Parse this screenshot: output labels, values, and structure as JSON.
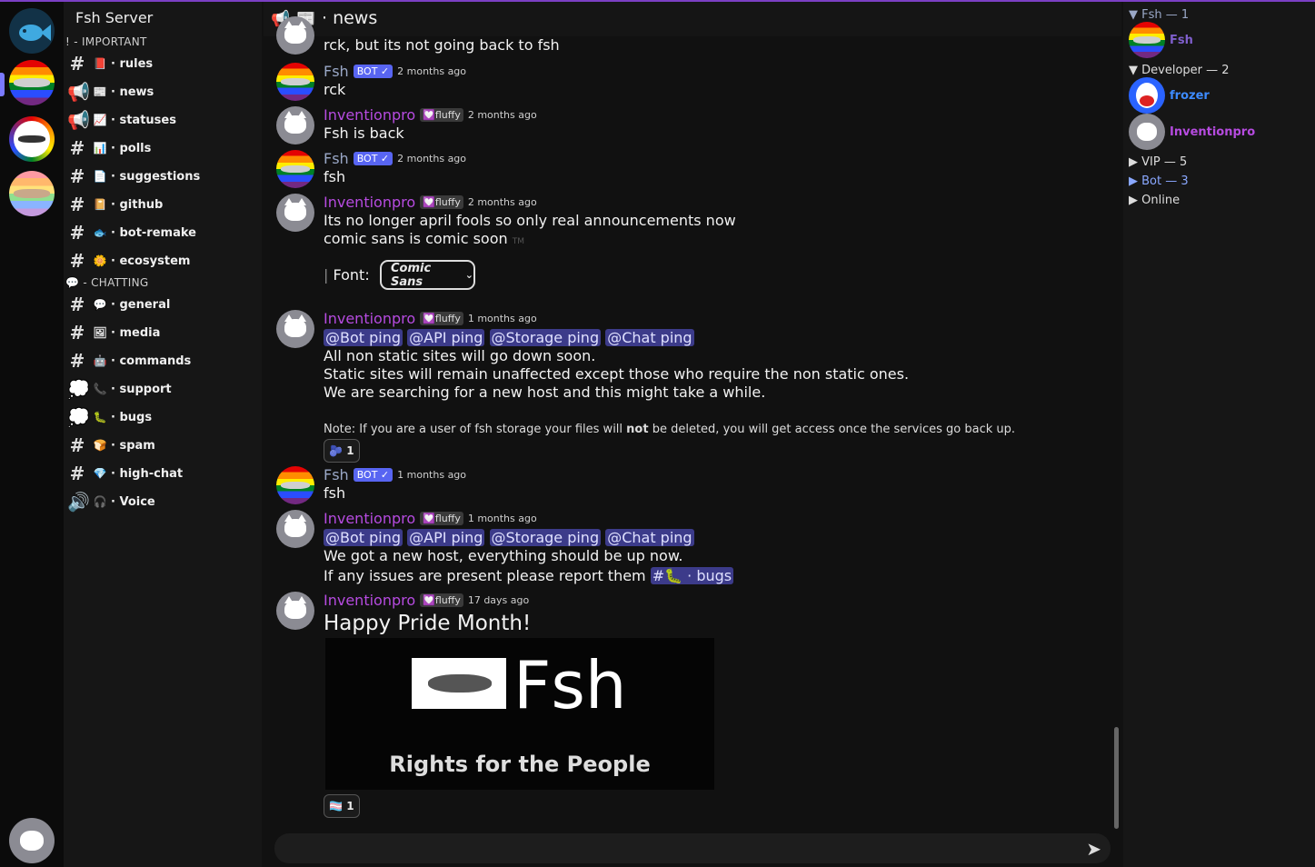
{
  "server": {
    "name": "Fsh Server"
  },
  "categories": [
    "! - IMPORTANT",
    "- CHATTING"
  ],
  "channels": [
    {
      "label": "· rules",
      "emoji": "📕",
      "kind": "text"
    },
    {
      "label": "· news",
      "emoji": "📰",
      "kind": "announce"
    },
    {
      "label": "· statuses",
      "emoji": "📈",
      "kind": "announce"
    },
    {
      "label": "· polls",
      "emoji": "📊",
      "kind": "text"
    },
    {
      "label": "· suggestions",
      "emoji": "📄",
      "kind": "text"
    },
    {
      "label": "· github",
      "emoji": "📔",
      "kind": "text"
    },
    {
      "label": "· bot-remake",
      "emoji": "🐟",
      "kind": "text"
    },
    {
      "label": "· ecosystem",
      "emoji": "🌼",
      "kind": "text"
    },
    {
      "label": "· general",
      "emoji": "💬",
      "kind": "text"
    },
    {
      "label": "· media",
      "emoji": "🖼",
      "kind": "text"
    },
    {
      "label": "· commands",
      "emoji": "🤖",
      "kind": "text"
    },
    {
      "label": "· support",
      "emoji": "📞",
      "kind": "forum"
    },
    {
      "label": "· bugs",
      "emoji": "🐛",
      "kind": "forum"
    },
    {
      "label": "· spam",
      "emoji": "🍞",
      "kind": "text"
    },
    {
      "label": "· high-chat",
      "emoji": "💎",
      "kind": "text"
    },
    {
      "label": "· Voice",
      "emoji": "🎧",
      "kind": "voice"
    }
  ],
  "header": {
    "title": "· news"
  },
  "messages": {
    "m0": {
      "text": "rck, but its not going back to fsh"
    },
    "m1": {
      "author": "Fsh",
      "badge": "BOT ✓",
      "time": "2 months ago",
      "text": "rck"
    },
    "m2": {
      "author": "Inventionpro",
      "tag": "💟fluffy",
      "time": "2 months ago",
      "text": "Fsh is back"
    },
    "m3": {
      "author": "Fsh",
      "badge": "BOT ✓",
      "time": "2 months ago",
      "text": "fsh"
    },
    "m4": {
      "author": "Inventionpro",
      "tag": "💟fluffy",
      "time": "2 months ago",
      "line1": "Its no longer april fools so only real announcements now",
      "line2": "comic sans is comic soon",
      "tm": "TM",
      "font_label": "Font:",
      "font_value": "Comic Sans"
    },
    "m5": {
      "author": "Inventionpro",
      "tag": "💟fluffy",
      "time": "1 months ago",
      "pings": [
        "@Bot ping",
        "@API ping",
        "@Storage ping",
        "@Chat ping"
      ],
      "line1": "All non static sites will go down soon.",
      "line2": "Static sites will remain unaffected except those who require the non static ones.",
      "line3": "We are searching for a new host and this might take a while.",
      "note_pre": "Note: If you are a user of fsh storage your files will ",
      "note_bold": "not",
      "note_post": " be deleted, you will get access once the services go back up.",
      "reaction_emoji": "🫐",
      "reaction_count": "1"
    },
    "m6": {
      "author": "Fsh",
      "badge": "BOT ✓",
      "time": "1 months ago",
      "text": "fsh"
    },
    "m7": {
      "author": "Inventionpro",
      "tag": "💟fluffy",
      "time": "1 months ago",
      "pings": [
        "@Bot ping",
        "@API ping",
        "@Storage ping",
        "@Chat ping"
      ],
      "line1": "We got a new host, everything should be up now.",
      "line2": "If any issues are present please report them",
      "channel_mention": "#🐛 · bugs"
    },
    "m8": {
      "author": "Inventionpro",
      "tag": "💟fluffy",
      "time": "17 days ago",
      "heading": "Happy Pride Month!",
      "banner_word": "Fsh",
      "banner_sub": "Rights for the People",
      "reaction_emoji": "🏳️‍⚧️",
      "reaction_count": "1"
    }
  },
  "members": {
    "groups": [
      "▼ Fsh — 1",
      "▼ Developer — 2",
      "▶ VIP — 5",
      "▶ Bot — 3",
      "▶ Online"
    ],
    "list": [
      {
        "name": "Fsh",
        "color": "#7f5fcc"
      },
      {
        "name": "frozer",
        "color": "#3d8bff"
      },
      {
        "name": "Inventionpro",
        "color": "#b64be0"
      }
    ]
  },
  "colors": {
    "accent": "#5865f2",
    "ping_bg": "#3c3b8a",
    "author": "#b64be0"
  }
}
